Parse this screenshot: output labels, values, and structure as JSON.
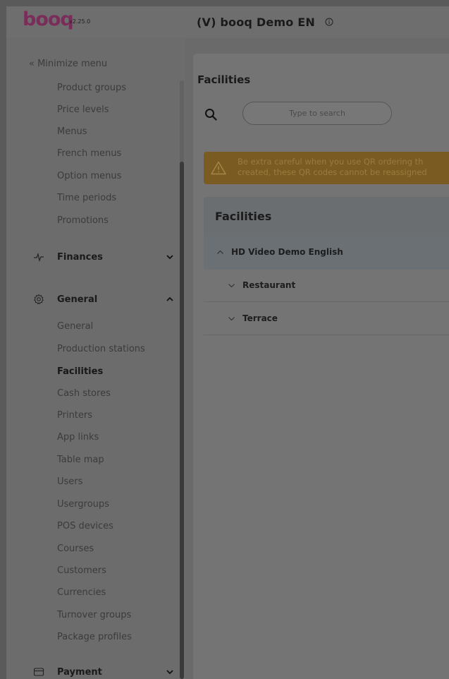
{
  "header": {
    "logo": "booq",
    "version": "v2.25.0",
    "venue": "(V) booq Demo EN"
  },
  "sidebar": {
    "minimize_label": "« Minimize menu",
    "items_top": [
      "Product groups",
      "Price levels",
      "Menus",
      "French menus",
      "Option menus",
      "Time periods",
      "Promotions"
    ],
    "section_finances": "Finances",
    "section_general": "General",
    "items_general": [
      "General",
      "Production stations",
      "Facilities",
      "Cash stores",
      "Printers",
      "App links",
      "Table map",
      "Users",
      "Usergroups",
      "POS devices",
      "Courses",
      "Customers",
      "Currencies",
      "Turnover groups",
      "Package profiles"
    ],
    "active_item": "Facilities",
    "section_payment": "Payment"
  },
  "main": {
    "title": "Facilities",
    "search_placeholder": "Type to search",
    "warning_line1": "Be extra careful when you use QR ordering th",
    "warning_line2": "created, these QR codes cannot be reassigned",
    "card_title": "Facilities",
    "rows": [
      {
        "label": "HD Video Demo English",
        "expanded": true
      },
      {
        "label": "Restaurant",
        "expanded": false
      },
      {
        "label": "Terrace",
        "expanded": false
      }
    ]
  },
  "colors": {
    "overlay": "#6f6f6f",
    "brand": "#7a2d5a",
    "warning": "#7a5c22"
  }
}
